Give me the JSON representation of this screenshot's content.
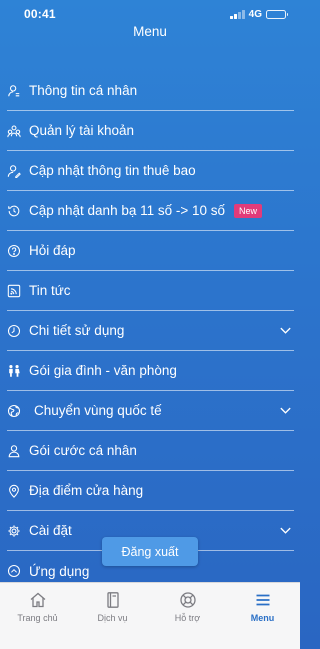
{
  "status": {
    "time": "00:41",
    "network": "4G"
  },
  "header": {
    "title": "Menu"
  },
  "menu": {
    "items": [
      {
        "label": "Thông tin cá nhân",
        "icon": "person-info-icon"
      },
      {
        "label": "Quản lý tài khoản",
        "icon": "accounts-icon"
      },
      {
        "label": "Cập nhật thông tin thuê bao",
        "icon": "person-edit-icon"
      },
      {
        "label": "Cập nhật danh bạ 11 số -> 10 số",
        "icon": "history-icon",
        "badge": "New"
      },
      {
        "label": "Hỏi đáp",
        "icon": "question-icon"
      },
      {
        "label": "Tin tức",
        "icon": "rss-icon"
      },
      {
        "label": "Chi tiết sử dụng",
        "icon": "clock-icon",
        "expandable": true
      },
      {
        "label": "Gói gia đình - văn phòng",
        "icon": "family-icon"
      },
      {
        "label": "Chuyển vùng quốc tế",
        "icon": "globe-icon",
        "expandable": true
      },
      {
        "label": "Gói cước cá nhân",
        "icon": "person-icon"
      },
      {
        "label": "Địa điểm cửa hàng",
        "icon": "location-pin-icon"
      },
      {
        "label": "Cài đặt",
        "icon": "gear-icon",
        "expandable": true
      },
      {
        "label": "Ứng dụng",
        "icon": "chevron-circle-up-icon"
      }
    ]
  },
  "logout_label": "Đăng xuất",
  "tabs": [
    {
      "label": "Trang chủ",
      "icon": "home-icon",
      "active": false
    },
    {
      "label": "Dịch vụ",
      "icon": "book-icon",
      "active": false
    },
    {
      "label": "Hỗ trợ",
      "icon": "lifebuoy-icon",
      "active": false
    },
    {
      "label": "Menu",
      "icon": "hamburger-icon",
      "active": true
    }
  ],
  "colors": {
    "accent": "#2a6fc6",
    "badge": "#e23b7a",
    "background": "#2c74cc"
  }
}
